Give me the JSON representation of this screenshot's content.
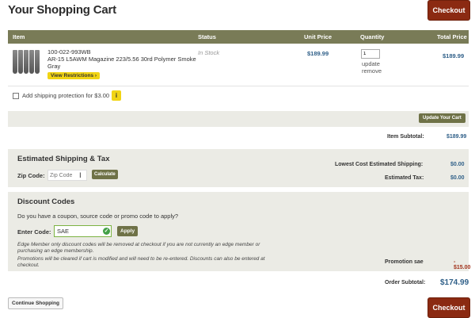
{
  "page": {
    "title": "Your Shopping Cart"
  },
  "checkout": {
    "label": "Checkout"
  },
  "table": {
    "headers": {
      "item": "Item",
      "status": "Status",
      "unit_price": "Unit Price",
      "quantity": "Quantity",
      "total_price": "Total Price"
    }
  },
  "item": {
    "sku": "100-022-993WB",
    "name": "AR-15 L5AWM Magazine 223/5.56 30rd Polymer Smoke Gray",
    "restrictions_label": "View Restrictions ›",
    "status": "In Stock",
    "unit_price": "$189.99",
    "quantity": "1",
    "update_label": "update",
    "remove_label": "remove",
    "total_price": "$189.99",
    "image_icon": "magazine-icon"
  },
  "shipping_protection": {
    "label": "Add shipping protection for $3.00",
    "info": "i"
  },
  "update_cart": {
    "label": "Update Your Cart"
  },
  "subtotal": {
    "label": "Item Subtotal:",
    "value": "$189.99"
  },
  "shipping": {
    "title": "Estimated Shipping & Tax",
    "zip_label": "Zip Code:",
    "zip_placeholder": "Zip Code",
    "calculate_label": "Calculate",
    "est_label": "Lowest Cost Estimated Shipping:",
    "est_value": "$0.00",
    "tax_label": "Estimated Tax:",
    "tax_value": "$0.00"
  },
  "discount": {
    "title": "Discount Codes",
    "question": "Do you have a coupon, source code or promo code to apply?",
    "code_label": "Enter Code:",
    "code_value": "SAE",
    "apply_label": "Apply",
    "note1": "Edge Member only discount codes will be removed at checkout if you are not currently an edge member or purchasing an edge membership.",
    "note2": "Promotions will be cleared if cart is modified and will need to be re-entered. Discounts can also be entered at checkout.",
    "promo_label": "Promotion sae",
    "promo_value": "- $15.00"
  },
  "order": {
    "subtotal_label": "Order Subtotal:",
    "subtotal_value": "$174.99"
  },
  "continue": {
    "label": "Continue Shopping"
  },
  "colors": {
    "header": "#797b57",
    "checkout": "#8b2a12",
    "price": "#2f5f88",
    "highlight": "#f1d414",
    "panel": "#ebebe5"
  }
}
